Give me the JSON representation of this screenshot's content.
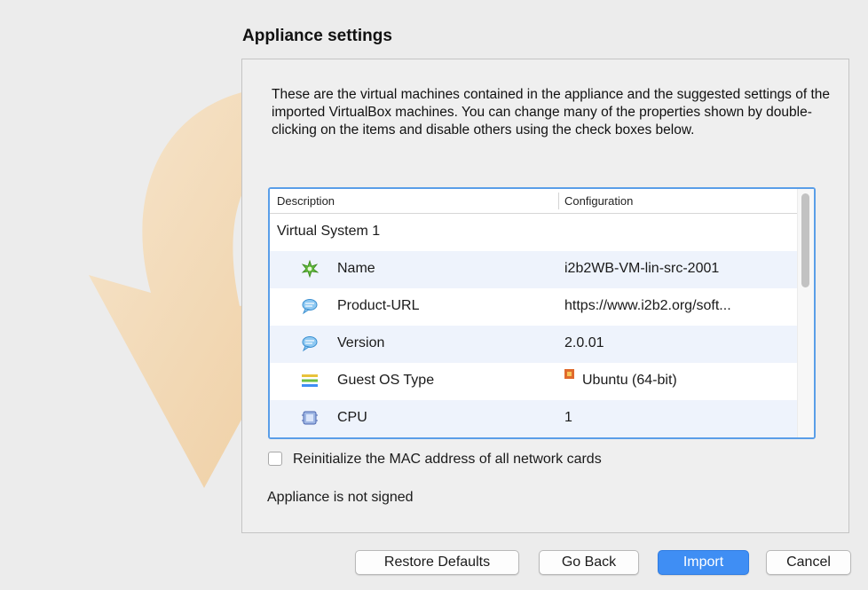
{
  "page_title": "Appliance settings",
  "description": "These are the virtual machines contained in the appliance and the suggested settings of the imported VirtualBox machines. You can change many of the properties shown by double-clicking on the items and disable others using the check boxes below.",
  "table": {
    "columns": [
      "Description",
      "Configuration"
    ],
    "rows": [
      {
        "label": "Virtual System 1",
        "value": "",
        "icon": ""
      },
      {
        "label": "Name",
        "value": "i2b2WB-VM-lin-src-2001",
        "icon": "name-icon"
      },
      {
        "label": "Product-URL",
        "value": "https://www.i2b2.org/soft...",
        "icon": "speech-bubble-icon"
      },
      {
        "label": "Version",
        "value": "2.0.01",
        "icon": "speech-bubble-icon"
      },
      {
        "label": "Guest OS Type",
        "value": "Ubuntu (64-bit)",
        "icon": "os-type-icon"
      },
      {
        "label": "CPU",
        "value": "1",
        "icon": "cpu-icon"
      }
    ]
  },
  "checkbox": {
    "label": "Reinitialize the MAC address of all network cards",
    "checked": false
  },
  "signed_status": "Appliance is not signed",
  "buttons": {
    "restore_defaults": "Restore Defaults",
    "go_back": "Go Back",
    "import": "Import",
    "cancel": "Cancel"
  },
  "colors": {
    "accent": "#3f8ef4",
    "focus_ring": "#5a9ee8",
    "alt_row": "#eef3fc"
  }
}
